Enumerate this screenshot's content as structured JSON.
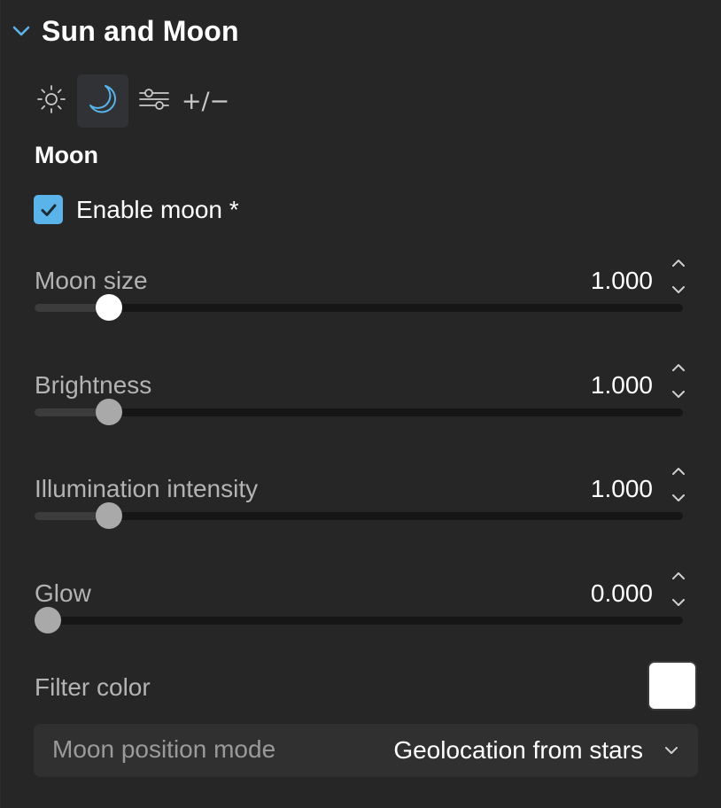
{
  "header": {
    "title": "Sun and Moon",
    "chevron_icon": "chevron-down-icon",
    "accent_color": "#5ab4ea"
  },
  "tabs": [
    {
      "icon": "sun-icon",
      "active": false
    },
    {
      "icon": "moon-icon",
      "active": true
    },
    {
      "icon": "sliders-icon",
      "active": false
    },
    {
      "icon": "plus-minus-icon",
      "label": "+/−",
      "active": false
    }
  ],
  "section": {
    "title": "Moon"
  },
  "enable_moon": {
    "label": "Enable moon *",
    "checked": true
  },
  "sliders": [
    {
      "label": "Moon size",
      "value": "1.000",
      "fraction": 0.115
    },
    {
      "label": "Brightness",
      "value": "1.000",
      "fraction": 0.115
    },
    {
      "label": "Illumination intensity",
      "value": "1.000",
      "fraction": 0.115
    },
    {
      "label": "Glow",
      "value": "0.000",
      "fraction": 0.02
    }
  ],
  "filter_color": {
    "label": "Filter color",
    "color": "#ffffff"
  },
  "moon_position_mode": {
    "label": "Moon position mode",
    "selected": "Geolocation from stars"
  }
}
